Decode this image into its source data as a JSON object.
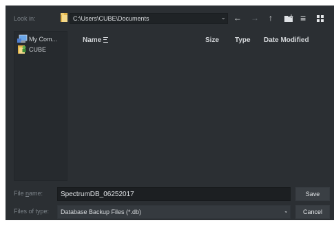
{
  "toolbar": {
    "look_in_label": "Look in:",
    "path": "C:\\Users\\CUBE\\Documents",
    "icons": [
      "folder-icon",
      "back-arrow-icon",
      "forward-arrow-icon",
      "up-arrow-icon",
      "new-folder-icon",
      "list-view-icon",
      "detail-view-icon"
    ],
    "back_glyph": "←",
    "forward_glyph": "→",
    "up_glyph": "↑",
    "list_glyph": "≡",
    "chevron_glyph": "⌄"
  },
  "sidebar": {
    "items": [
      {
        "label": "My Com...",
        "icon": "computer-icon"
      },
      {
        "label": "CUBE",
        "icon": "user-folder-icon"
      }
    ]
  },
  "file_list": {
    "columns": [
      "Name",
      "Size",
      "Type",
      "Date Modified"
    ]
  },
  "file_name": {
    "label_prefix": "File ",
    "label_underlined": "n",
    "label_suffix": "ame:",
    "value": "SpectrumDB_06252017"
  },
  "file_type": {
    "label": "Files of type:",
    "selected": "Database Backup Files (*.db)"
  },
  "buttons": {
    "save": "Save",
    "cancel": "Cancel"
  },
  "colors": {
    "background": "#2b2f33",
    "sidebar": "#262a2e",
    "input": "#1c1f22",
    "text": "#cfd3d6",
    "dim_text": "#7b8288"
  }
}
